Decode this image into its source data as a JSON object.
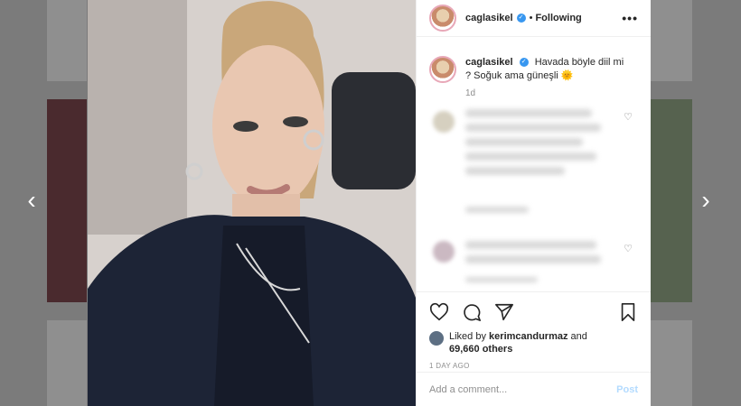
{
  "post": {
    "username": "caglasikel",
    "verified_icon": "verified-badge-icon",
    "follow_status": "Following",
    "dot": "•",
    "caption_text": "Havada böyle diil mi ? Soğuk ama güneşli 🌞",
    "caption_time": "1d",
    "liked_by_prefix": "Liked by",
    "liked_by_user": "kerimcandurmaz",
    "liked_by_and": "and",
    "likes_count": "69,660 others",
    "posted_ago": "1 DAY AGO",
    "comment_placeholder": "Add a comment...",
    "post_button": "Post"
  },
  "nav": {
    "prev_icon": "‹",
    "next_icon": "›"
  },
  "icons": {
    "more": "•••",
    "heart": "♡"
  },
  "colors": {
    "accent_blue": "#3897f0",
    "post_disabled": "#b3dbff",
    "overlay": "#7b7b7b"
  }
}
